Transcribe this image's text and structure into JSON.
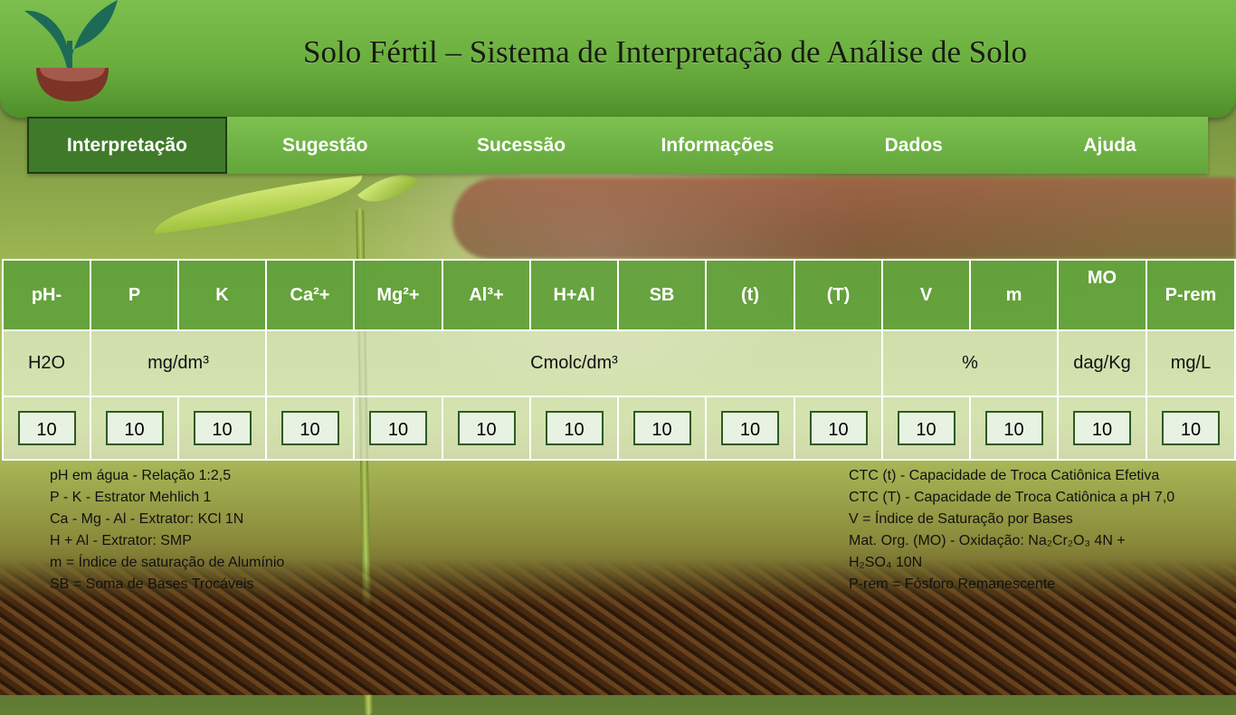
{
  "header": {
    "title": "Solo Fértil – Sistema de Interpretação de Análise de Solo"
  },
  "nav": {
    "items": [
      "Interpretação",
      "Sugestão",
      "Sucessão",
      "Informações",
      "Dados",
      "Ajuda"
    ],
    "active": "Interpretação"
  },
  "table": {
    "headers": [
      "pH-",
      "P",
      "K",
      "Ca²+",
      "Mg²+",
      "Al³+",
      "H+Al",
      "SB",
      "(t)",
      "(T)",
      "V",
      "m",
      "MO",
      "P-rem"
    ],
    "units": {
      "ph": "H2O",
      "pk": "mg/dm³",
      "cmolc": "Cmolc/dm³",
      "percent": "%",
      "mo": "dag/Kg",
      "prem": "mg/L"
    },
    "values": [
      "10",
      "10",
      "10",
      "10",
      "10",
      "10",
      "10",
      "10",
      "10",
      "10",
      "10",
      "10",
      "10",
      "10"
    ]
  },
  "notes_left": [
    "pH em água - Relação 1:2,5",
    "P - K - Estrator Mehlich 1",
    "Ca - Mg - Al - Extrator: KCl 1N",
    "H + Al - Extrator: SMP",
    "m = Índice de saturação de Alumínio",
    "SB = Soma de Bases Trocáveis"
  ],
  "notes_right": [
    "CTC (t) - Capacidade de Troca Catiônica Efetiva",
    "CTC (T) - Capacidade de Troca Catiônica a pH 7,0",
    "V = Índice de Saturação por Bases",
    "Mat. Org. (MO) - Oxidação: Na₂Cr₂O₃ 4N +",
    "H₂SO₄ 10N",
    "P-rem = Fósforo Remanescente"
  ],
  "colors": {
    "header": "#6aae3e",
    "nav": "#7dc150",
    "nav_active": "#3f7a2a",
    "table_header": "#60a03a"
  },
  "icons": {
    "logo": "seedling-pot-logo"
  }
}
